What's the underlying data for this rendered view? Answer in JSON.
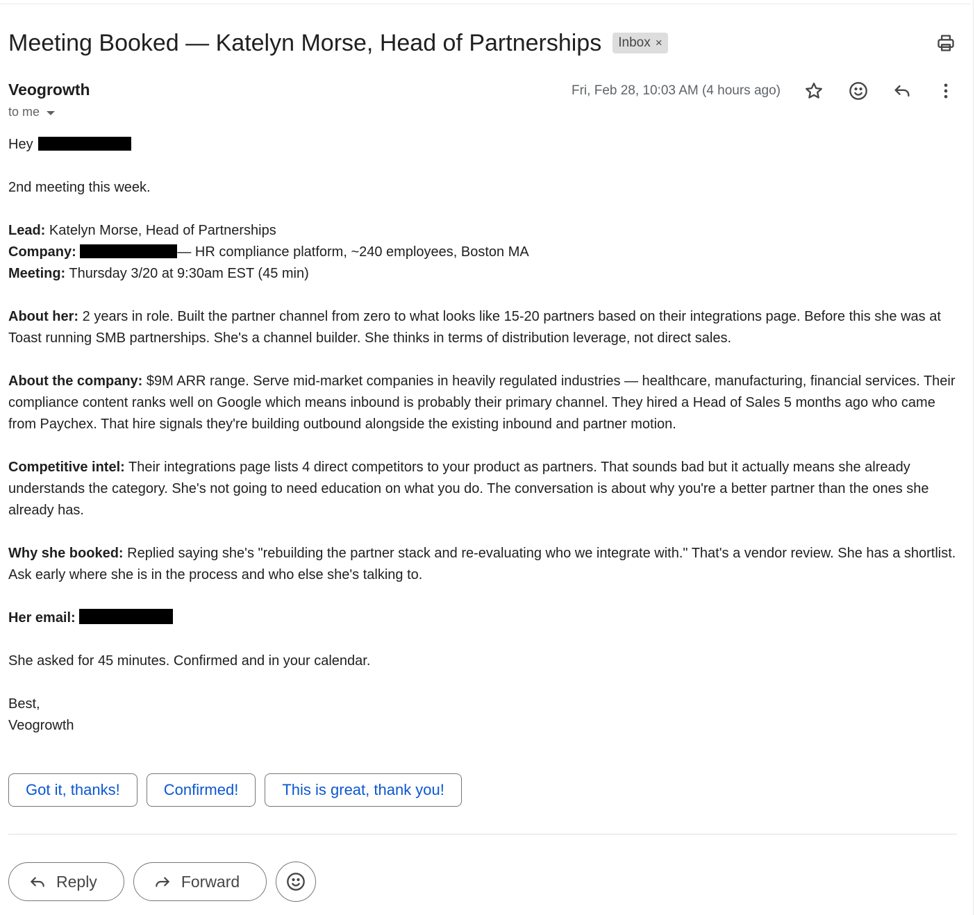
{
  "email": {
    "subject": "Meeting Booked — Katelyn Morse, Head of Partnerships",
    "label": "Inbox",
    "label_close": "×",
    "sender": "Veogrowth",
    "recipient": "to me",
    "date": "Fri, Feb 28, 10:03 AM (4 hours ago)"
  },
  "body": {
    "greeting": "Hey",
    "intro": "2nd meeting this week.",
    "lead_label": "Lead:",
    "lead_value": " Katelyn Morse, Head of Partnerships",
    "company_label": "Company:",
    "company_value": "— HR compliance platform, ~240 employees, Boston MA",
    "meeting_label": "Meeting:",
    "meeting_value": " Thursday 3/20 at 9:30am EST (45 min)",
    "about_her_label": "About her:",
    "about_her_value": " 2 years in role. Built the partner channel from zero to what looks like 15-20 partners based on their integrations page. Before this she was at Toast running SMB partnerships. She's a channel builder. She thinks in terms of distribution leverage, not direct sales.",
    "about_company_label": "About the company:",
    "about_company_value": " $9M ARR range. Serve mid-market companies in heavily regulated industries — healthcare, manufacturing, financial services. Their compliance content ranks well on Google which means inbound is probably their primary channel. They hired a Head of Sales 5 months ago who came from Paychex. That hire signals they're building outbound alongside the existing inbound and partner motion.",
    "competitive_label": "Competitive intel:",
    "competitive_value": " Their integrations page lists 4 direct competitors to your product as partners. That sounds bad but it actually means she already understands the category. She's not going to need education on what you do. The conversation is about why you're a better partner than the ones she already has.",
    "why_label": "Why she booked:",
    "why_value": " Replied saying she's \"rebuilding the partner stack and re-evaluating who we integrate with.\" That's a vendor review. She has a shortlist. Ask early where she is in the process and who else she's talking to.",
    "email_label": "Her email:",
    "closing_note": "She asked for 45 minutes. Confirmed and in your calendar.",
    "signoff": "Best,",
    "signature": "Veogrowth"
  },
  "smart_replies": [
    "Got it, thanks!",
    "Confirmed!",
    "This is great, thank you!"
  ],
  "actions": {
    "reply": "Reply",
    "forward": "Forward"
  },
  "icons": [
    "print-icon",
    "star-icon",
    "emoji-icon",
    "reply-icon",
    "more-vert-icon",
    "forward-icon"
  ],
  "colors": {
    "link_blue": "#0b57d0",
    "chip_bg": "#dddddd",
    "text": "#1f1f1f",
    "muted": "#5f6368"
  }
}
